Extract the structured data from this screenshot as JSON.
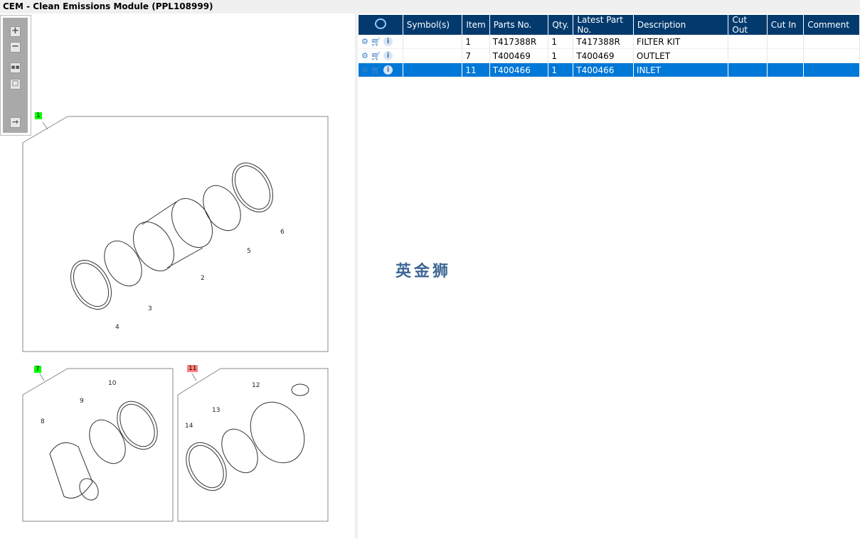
{
  "title": "CEM - Clean Emissions Module (PPL108999)",
  "toolbar": {
    "buttons": [
      "zoom-in",
      "zoom-out",
      "fit-all",
      "actual-size",
      "toggle-list"
    ]
  },
  "diagram": {
    "tags": [
      {
        "label": "1",
        "color": "#00ff00"
      },
      {
        "label": "7",
        "color": "#00ff00"
      },
      {
        "label": "11",
        "color": "#ff8080"
      }
    ],
    "callouts": [
      "2",
      "3",
      "4",
      "5",
      "6",
      "8",
      "9",
      "10",
      "12",
      "13",
      "14"
    ]
  },
  "table": {
    "columns": [
      "Symbol(s)",
      "Item",
      "Parts No.",
      "Qty.",
      "Latest Part No.",
      "Description",
      "Cut Out",
      "Cut In",
      "Comment"
    ],
    "rows": [
      {
        "symbols": "",
        "item": "1",
        "part": "T417388R",
        "qty": "1",
        "latest": "T417388R",
        "desc": "FILTER KIT",
        "cutout": "",
        "cutin": "",
        "comment": "",
        "selected": false
      },
      {
        "symbols": "",
        "item": "7",
        "part": "T400469",
        "qty": "1",
        "latest": "T400469",
        "desc": "OUTLET",
        "cutout": "",
        "cutin": "",
        "comment": "",
        "selected": false
      },
      {
        "symbols": "",
        "item": "11",
        "part": "T400466",
        "qty": "1",
        "latest": "T400466",
        "desc": "INLET",
        "cutout": "",
        "cutin": "",
        "comment": "",
        "selected": true
      }
    ]
  },
  "watermark": "英金狮",
  "colors": {
    "header": "#033a6e",
    "selected": "#0078d7"
  }
}
